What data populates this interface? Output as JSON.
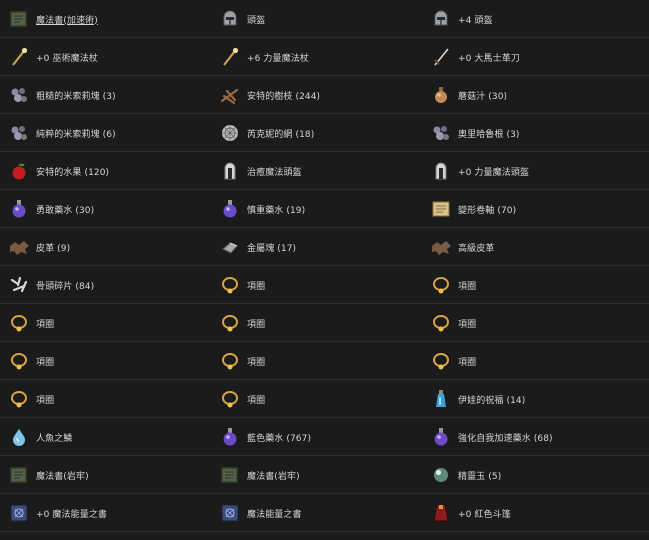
{
  "colors": {
    "background": "#1b1b1c",
    "divider": "#2c2c2d",
    "text": "#d6d6d6"
  },
  "items": [
    {
      "label": "魔法書(加速術)",
      "icon": "spellbook-icon",
      "link": true
    },
    {
      "label": "頭盔",
      "icon": "helmet-icon"
    },
    {
      "label": "+4 頭盔",
      "icon": "helmet-icon"
    },
    {
      "label": "+0 巫術魔法杖",
      "icon": "wand-icon"
    },
    {
      "label": "+6 力量魔法杖",
      "icon": "wand-icon"
    },
    {
      "label": "+0 大馬士革刀",
      "icon": "sword-icon"
    },
    {
      "label": "粗糙的米索莉塊 (3)",
      "icon": "ore-icon"
    },
    {
      "label": "安特的樹枝 (244)",
      "icon": "branch-icon"
    },
    {
      "label": "蘑菇汁 (30)",
      "icon": "bottle-icon"
    },
    {
      "label": "純粹的米索莉塊 (6)",
      "icon": "ore-icon"
    },
    {
      "label": "芮克妮的網 (18)",
      "icon": "web-icon"
    },
    {
      "label": "奧里哈魯根 (3)",
      "icon": "ore-icon"
    },
    {
      "label": "安特的水果 (120)",
      "icon": "apple-icon"
    },
    {
      "label": "治癒魔法頭盔",
      "icon": "hood-icon"
    },
    {
      "label": "+0 力量魔法頭盔",
      "icon": "hood-icon"
    },
    {
      "label": "勇敢藥水 (30)",
      "icon": "potion-icon"
    },
    {
      "label": "慎重藥水 (19)",
      "icon": "potion-icon"
    },
    {
      "label": "變形卷軸 (70)",
      "icon": "scroll-icon"
    },
    {
      "label": "皮革 (9)",
      "icon": "leather-icon"
    },
    {
      "label": "金屬塊 (17)",
      "icon": "metal-icon"
    },
    {
      "label": "高級皮革",
      "icon": "leather-icon"
    },
    {
      "label": "骨頭碎片 (84)",
      "icon": "bones-icon"
    },
    {
      "label": "項圈",
      "icon": "necklace-icon"
    },
    {
      "label": "項圈",
      "icon": "necklace-icon"
    },
    {
      "label": "項圈",
      "icon": "necklace-icon"
    },
    {
      "label": "項圈",
      "icon": "necklace-icon"
    },
    {
      "label": "項圈",
      "icon": "necklace-icon"
    },
    {
      "label": "項圈",
      "icon": "necklace-icon"
    },
    {
      "label": "項圈",
      "icon": "necklace-icon"
    },
    {
      "label": "項圈",
      "icon": "necklace-icon"
    },
    {
      "label": "項圈",
      "icon": "necklace-icon"
    },
    {
      "label": "項圈",
      "icon": "necklace-icon"
    },
    {
      "label": "伊娃的祝福 (14)",
      "icon": "vial-icon"
    },
    {
      "label": "人魚之鱗",
      "icon": "drop-icon"
    },
    {
      "label": "藍色藥水 (767)",
      "icon": "potion-icon"
    },
    {
      "label": "強化自我加速藥水 (68)",
      "icon": "potion-icon"
    },
    {
      "label": "魔法書(岩牢)",
      "icon": "spellbook-icon"
    },
    {
      "label": "魔法書(岩牢)",
      "icon": "spellbook-icon"
    },
    {
      "label": "精靈玉 (5)",
      "icon": "orb-icon"
    },
    {
      "label": "+0 魔法能量之書",
      "icon": "magic-book-icon"
    },
    {
      "label": "魔法能量之書",
      "icon": "magic-book-icon"
    },
    {
      "label": "+0 紅色斗篷",
      "icon": "cloak-icon"
    }
  ]
}
